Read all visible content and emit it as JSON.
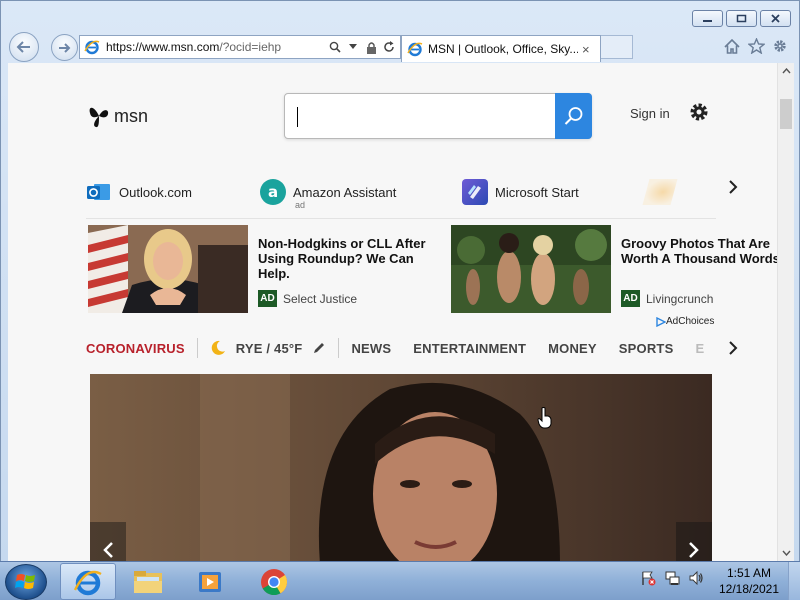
{
  "browser": {
    "url_main": "https://www.msn.com",
    "url_rest": "/?ocid=iehp",
    "tab_title": "MSN | Outlook, Office, Sky...",
    "tab_close": "×",
    "controls": [
      "minimize",
      "restore",
      "close"
    ]
  },
  "header": {
    "logo_text": "msn",
    "search": {
      "value": "",
      "placeholder": ""
    },
    "signin_label": "Sign in"
  },
  "quicklinks": [
    {
      "label": "Outlook.com",
      "icon": "outlook-icon",
      "color": "#0f6cbd"
    },
    {
      "label": "Amazon Assistant",
      "sub": "ad",
      "icon": "amazon-icon",
      "color": "#1aa39d"
    },
    {
      "label": "Microsoft Start",
      "icon": "microsoft-start-icon",
      "color": "#5a4ec1"
    }
  ],
  "ads": [
    {
      "title": "Non-Hodgkins or CLL After Using Roundup? We Can Help.",
      "badge": "AD",
      "source": "Select Justice"
    },
    {
      "title": "Groovy Photos That Are Worth A Thousand Words",
      "badge": "AD",
      "source": "Livingcrunch"
    }
  ],
  "adchoices": "AdChoices",
  "categories": {
    "corona": "CORONAVIRUS",
    "weather": "RYE / 45°F",
    "items": [
      "NEWS",
      "ENTERTAINMENT",
      "MONEY",
      "SPORTS",
      "E"
    ]
  },
  "taskbar": {
    "time": "1:51 AM",
    "date": "12/18/2021"
  },
  "colors": {
    "accent": "#2d86e0",
    "corona": "#b8212b",
    "ad_badge": "#1d5a26"
  }
}
